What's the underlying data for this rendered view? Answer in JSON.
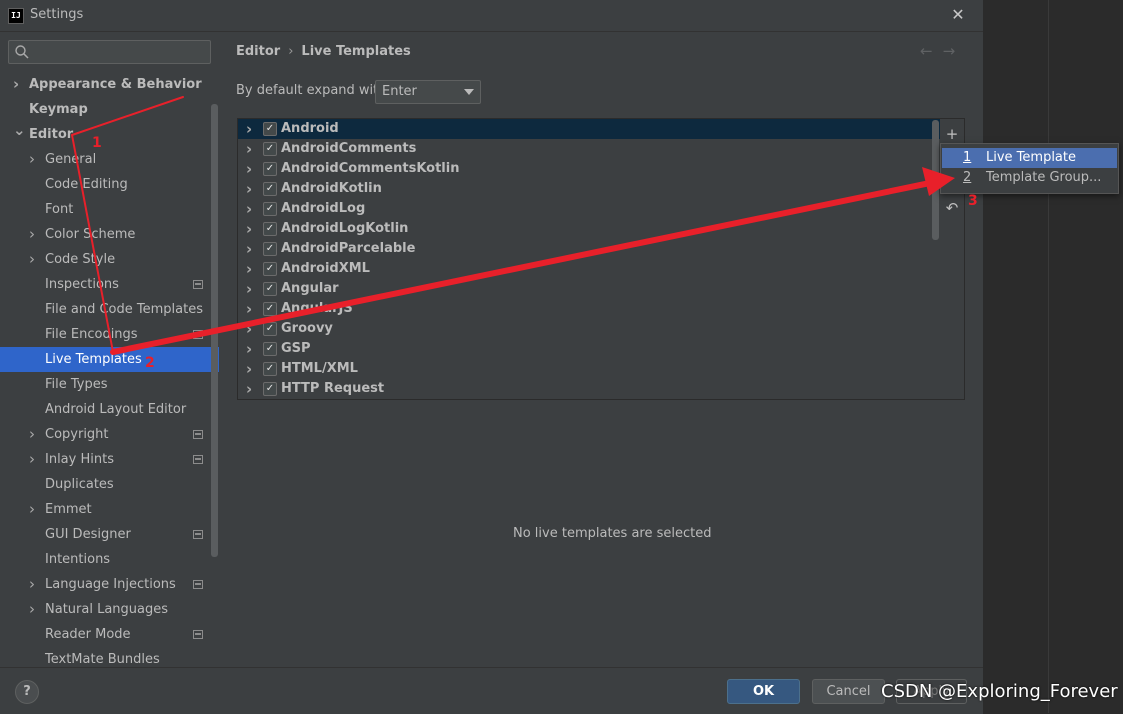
{
  "window": {
    "title": "Settings",
    "app_icon_text": "IJ",
    "close_icon": "close-icon"
  },
  "search": {
    "placeholder": "",
    "value": ""
  },
  "sidebar": {
    "items": [
      {
        "label": "Appearance & Behavior",
        "level": 0,
        "expandable": true,
        "expanded": false,
        "bold": true,
        "badge": false
      },
      {
        "label": "Keymap",
        "level": 0,
        "expandable": false,
        "bold": true,
        "badge": false
      },
      {
        "label": "Editor",
        "level": 0,
        "expandable": true,
        "expanded": true,
        "bold": true,
        "badge": false
      },
      {
        "label": "General",
        "level": 1,
        "expandable": true,
        "expanded": false,
        "badge": false
      },
      {
        "label": "Code Editing",
        "level": 1,
        "expandable": false,
        "badge": false
      },
      {
        "label": "Font",
        "level": 1,
        "expandable": false,
        "badge": false
      },
      {
        "label": "Color Scheme",
        "level": 1,
        "expandable": true,
        "expanded": false,
        "badge": false
      },
      {
        "label": "Code Style",
        "level": 1,
        "expandable": true,
        "expanded": false,
        "badge": false
      },
      {
        "label": "Inspections",
        "level": 1,
        "expandable": false,
        "badge": true
      },
      {
        "label": "File and Code Templates",
        "level": 1,
        "expandable": false,
        "badge": false
      },
      {
        "label": "File Encodings",
        "level": 1,
        "expandable": false,
        "badge": true
      },
      {
        "label": "Live Templates",
        "level": 1,
        "expandable": false,
        "badge": false,
        "selected": true
      },
      {
        "label": "File Types",
        "level": 1,
        "expandable": false,
        "badge": false
      },
      {
        "label": "Android Layout Editor",
        "level": 1,
        "expandable": false,
        "badge": false
      },
      {
        "label": "Copyright",
        "level": 1,
        "expandable": true,
        "expanded": false,
        "badge": true
      },
      {
        "label": "Inlay Hints",
        "level": 1,
        "expandable": true,
        "expanded": false,
        "badge": true
      },
      {
        "label": "Duplicates",
        "level": 1,
        "expandable": false,
        "badge": false
      },
      {
        "label": "Emmet",
        "level": 1,
        "expandable": true,
        "expanded": false,
        "badge": false
      },
      {
        "label": "GUI Designer",
        "level": 1,
        "expandable": false,
        "badge": true
      },
      {
        "label": "Intentions",
        "level": 1,
        "expandable": false,
        "badge": false
      },
      {
        "label": "Language Injections",
        "level": 1,
        "expandable": true,
        "expanded": false,
        "badge": true
      },
      {
        "label": "Natural Languages",
        "level": 1,
        "expandable": true,
        "expanded": false,
        "badge": false
      },
      {
        "label": "Reader Mode",
        "level": 1,
        "expandable": false,
        "badge": true
      },
      {
        "label": "TextMate Bundles",
        "level": 1,
        "expandable": false,
        "badge": false
      }
    ]
  },
  "breadcrumb": {
    "parent": "Editor",
    "current": "Live Templates",
    "separator": "›"
  },
  "nav": {
    "back": "←",
    "forward": "→"
  },
  "expand_with": {
    "label": "By default expand with",
    "value": "Enter"
  },
  "template_groups": [
    {
      "name": "Android",
      "checked": true,
      "selected": true
    },
    {
      "name": "AndroidComments",
      "checked": true
    },
    {
      "name": "AndroidCommentsKotlin",
      "checked": true
    },
    {
      "name": "AndroidKotlin",
      "checked": true
    },
    {
      "name": "AndroidLog",
      "checked": true
    },
    {
      "name": "AndroidLogKotlin",
      "checked": true
    },
    {
      "name": "AndroidParcelable",
      "checked": true
    },
    {
      "name": "AndroidXML",
      "checked": true
    },
    {
      "name": "Angular",
      "checked": true
    },
    {
      "name": "AngularJS",
      "checked": true
    },
    {
      "name": "Groovy",
      "checked": true
    },
    {
      "name": "GSP",
      "checked": true
    },
    {
      "name": "HTML/XML",
      "checked": true
    },
    {
      "name": "HTTP Request",
      "checked": true
    }
  ],
  "toolbar": {
    "add_icon": "add-icon",
    "revert_icon": "undo-icon"
  },
  "popup": {
    "items": [
      {
        "num": "1",
        "label": "Live Template",
        "active": true
      },
      {
        "num": "2",
        "label": "Template Group...",
        "active": false
      }
    ]
  },
  "empty_message": "No live templates are selected",
  "footer": {
    "help": "?",
    "ok": "OK",
    "cancel": "Cancel",
    "apply": "Apply"
  },
  "annotations": {
    "marks": [
      "1",
      "2",
      "3"
    ],
    "color": "#e8202a"
  },
  "watermark": "CSDN @Exploring_Forever",
  "colors": {
    "selection": "#2f65ca",
    "list_selection": "#0d293e",
    "popup_active": "#4b6eaf",
    "ok_button": "#365880"
  }
}
